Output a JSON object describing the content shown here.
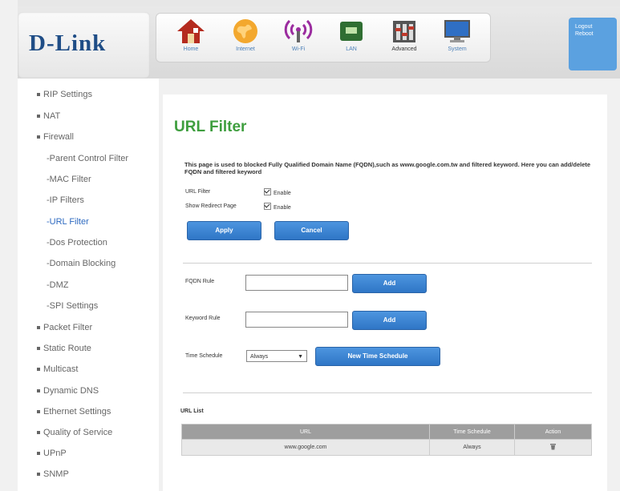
{
  "brand": {
    "logo": "D-Link"
  },
  "nav": [
    {
      "label": "Home",
      "icon": "home-icon"
    },
    {
      "label": "Internet",
      "icon": "globe-icon"
    },
    {
      "label": "Wi-Fi",
      "icon": "wifi-icon"
    },
    {
      "label": "LAN",
      "icon": "lan-icon"
    },
    {
      "label": "Advanced",
      "icon": "advanced-icon"
    },
    {
      "label": "System",
      "icon": "system-icon"
    }
  ],
  "header_right": {
    "logout": "Logout",
    "reboot": "Reboot"
  },
  "sidebar": {
    "items": [
      {
        "label": "RIP Settings",
        "sub": false
      },
      {
        "label": "NAT",
        "sub": false
      },
      {
        "label": "Firewall",
        "sub": false
      },
      {
        "label": "-Parent Control Filter",
        "sub": true
      },
      {
        "label": "-MAC Filter",
        "sub": true
      },
      {
        "label": "-IP Filters",
        "sub": true
      },
      {
        "label": "-URL Filter",
        "sub": true
      },
      {
        "label": "-Dos Protection",
        "sub": true
      },
      {
        "label": "-Domain Blocking",
        "sub": true
      },
      {
        "label": "-DMZ",
        "sub": true
      },
      {
        "label": "-SPI Settings",
        "sub": true
      },
      {
        "label": "Packet Filter",
        "sub": false
      },
      {
        "label": "Static Route",
        "sub": false
      },
      {
        "label": "Multicast",
        "sub": false
      },
      {
        "label": "Dynamic DNS",
        "sub": false
      },
      {
        "label": "Ethernet Settings",
        "sub": false
      },
      {
        "label": "Quality of Service",
        "sub": false
      },
      {
        "label": "UPnP",
        "sub": false
      },
      {
        "label": "SNMP",
        "sub": false
      }
    ]
  },
  "page": {
    "title": "URL Filter",
    "description": "This page is used to blocked Fully Qualified Domain Name (FQDN),such as www.google.com.tw and filtered keyword. Here you can add/delete FQDN and filtered keyword",
    "url_filter_label": "URL Filter",
    "url_filter_checkbox": "Enable",
    "show_redirect_label": "Show Redirect Page",
    "show_redirect_checkbox": "Enable",
    "apply": "Apply",
    "cancel": "Cancel",
    "fqdn_label": "FQDN Rule",
    "fqdn_value": "",
    "add_fqdn": "Add",
    "keyword_label": "Keyword Rule",
    "keyword_value": "",
    "add_keyword": "Add",
    "time_label": "Time Schedule",
    "time_value": "Always",
    "new_time": "New Time Schedule"
  },
  "url_list": {
    "title": "URL List",
    "headers": [
      "URL",
      "Time Schedule",
      "Action"
    ],
    "rows": [
      {
        "url": "www.google.com",
        "schedule": "Always",
        "action": "trash-icon"
      }
    ]
  }
}
